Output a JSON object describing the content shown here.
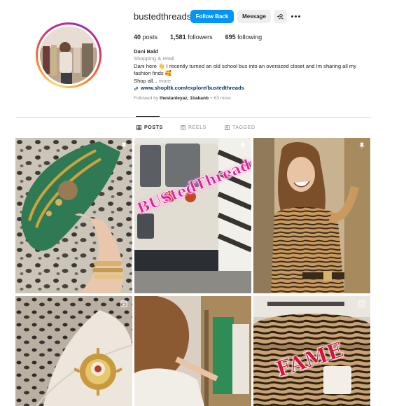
{
  "profile": {
    "username": "bustedthreads",
    "follow_label": "Follow Back",
    "message_label": "Message",
    "add_user_glyph": "+☺",
    "stats": {
      "posts_count": "40",
      "posts_label": "posts",
      "followers_count": "1,581",
      "followers_label": "followers",
      "following_count": "695",
      "following_label": "following"
    },
    "bio": {
      "name": "Dani Bald",
      "category": "Shopping & retail",
      "text_line1": "Dani here 👋 I recently turned an old school bus into an oversized closet and Im sharing all my",
      "text_line2": "fashion finds 🥰",
      "shop_text": "Shop all...",
      "more_label": "more",
      "link": "www.shopltk.com/explore/bustedthreads"
    },
    "followed_by": {
      "prefix": "Followed by",
      "names": "thestanleyaz, 1bakanb",
      "suffix": "+ 63 more"
    }
  },
  "tabs": [
    {
      "label": "POSTS",
      "icon": "grid-icon",
      "active": true
    },
    {
      "label": "REELS",
      "icon": "reels-icon",
      "active": false
    },
    {
      "label": "TAGGED",
      "icon": "tagged-icon",
      "active": false
    }
  ],
  "posts": [
    {
      "badge": "pin-icon",
      "description": "green sneakers with gold charms"
    },
    {
      "badge": "pin-icon",
      "overlay_text": "BUStedThreads"
    },
    {
      "badge": "pin-icon",
      "description": "woman in tiger print top"
    },
    {
      "badge": "reel-icon",
      "description": "brooch on white jacket"
    },
    {
      "badge": "",
      "description": "woman browsing racks"
    },
    {
      "badge": "reel-icon",
      "overlay_text": "FAME"
    }
  ],
  "colors": {
    "accent": "#0095f6",
    "link": "#00376b",
    "muted": "#8e8e8e",
    "text": "#262626",
    "button_secondary": "#efefef",
    "overlay_pink": "#e1209a"
  }
}
